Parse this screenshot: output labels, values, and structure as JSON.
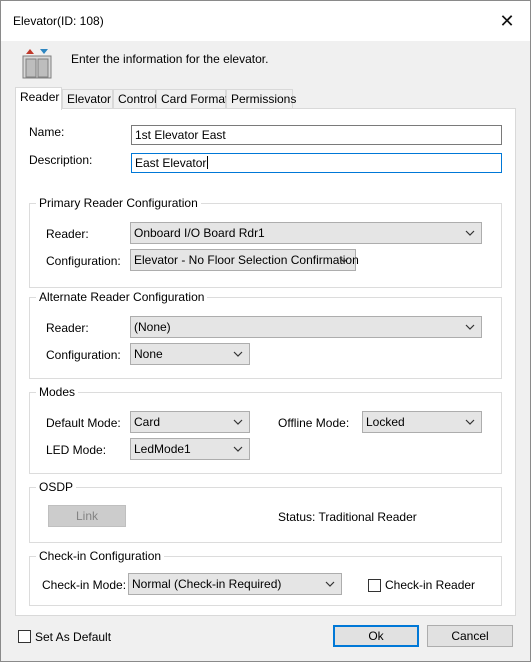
{
  "window": {
    "title": "Elevator(ID: 108)",
    "close_glyph": "✕"
  },
  "header": {
    "icon": "elevator-icon",
    "text": "Enter the information for the elevator."
  },
  "tabs": [
    {
      "label": "Reader",
      "active": true
    },
    {
      "label": "Elevator",
      "active": false
    },
    {
      "label": "Control",
      "active": false
    },
    {
      "label": "Card Format",
      "active": false
    },
    {
      "label": "Permissions",
      "active": false
    }
  ],
  "reader_tab": {
    "name_label": "Name:",
    "name_value": "1st Elevator East",
    "description_label": "Description:",
    "description_value": "East Elevator",
    "primary": {
      "title": "Primary Reader Configuration",
      "reader_label": "Reader:",
      "reader_value": "Onboard I/O Board Rdr1",
      "configuration_label": "Configuration:",
      "configuration_value": "Elevator - No Floor Selection Confirmation"
    },
    "alternate": {
      "title": "Alternate Reader Configuration",
      "reader_label": "Reader:",
      "reader_value": "(None)",
      "configuration_label": "Configuration:",
      "configuration_value": "None"
    },
    "modes": {
      "title": "Modes",
      "default_mode_label": "Default Mode:",
      "default_mode_value": "Card",
      "offline_mode_label": "Offline Mode:",
      "offline_mode_value": "Locked",
      "led_mode_label": "LED Mode:",
      "led_mode_value": "LedMode1"
    },
    "osdp": {
      "title": "OSDP",
      "link_label": "Link",
      "status_text": "Status: Traditional Reader"
    },
    "checkin": {
      "title": "Check-in Configuration",
      "mode_label": "Check-in Mode:",
      "mode_value": "Normal (Check-in Required)",
      "reader_checkbox_label": "Check-in Reader",
      "reader_checked": false
    }
  },
  "footer": {
    "set_default_label": "Set As Default",
    "set_default_checked": false,
    "ok_label": "Ok",
    "cancel_label": "Cancel"
  },
  "colors": {
    "focus_border": "#0078d7",
    "dialog_bg": "#f0f0f0",
    "panel_bg": "#ffffff"
  }
}
